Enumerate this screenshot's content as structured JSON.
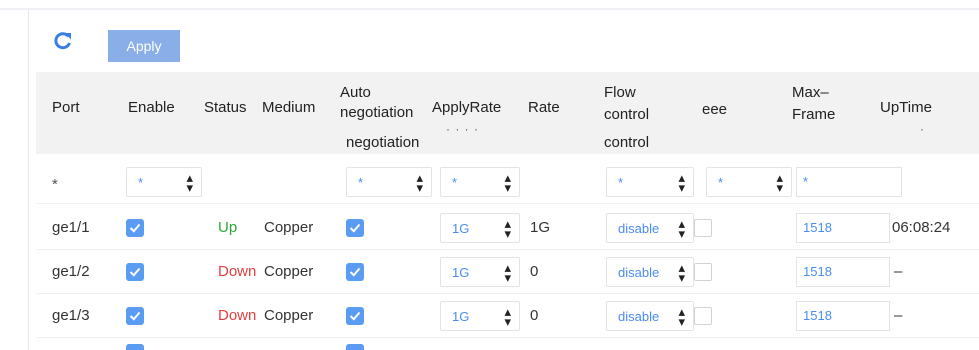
{
  "toolbar": {
    "apply_label": "Apply",
    "refresh_icon": "refresh-icon"
  },
  "columns": {
    "port": "Port",
    "enable": "Enable",
    "status": "Status",
    "medium": "Medium",
    "auto_line1": "Auto",
    "auto_line2": "negotiation",
    "auto_ghost": "negotiation",
    "applyrate": "ApplyRate",
    "rate": "Rate",
    "flow_line1": "Flow",
    "flow_line2": "control",
    "flow_ghost": "control",
    "eee": "eee",
    "max_line1": "Max–",
    "max_line2": "Frame",
    "uptime": "UpTime"
  },
  "filter": {
    "port": "*",
    "enable": "*",
    "auto": "*",
    "applyrate": "*",
    "flow": "*",
    "eee": "*",
    "maxframe": "*"
  },
  "rows": [
    {
      "port": "ge1/1",
      "enable": true,
      "status": "Up",
      "medium": "Copper",
      "auto": true,
      "applyrate": "1G",
      "rate": "1G",
      "flow": "disable",
      "eee": false,
      "maxframe": "1518",
      "uptime": "06:08:24"
    },
    {
      "port": "ge1/2",
      "enable": true,
      "status": "Down",
      "medium": "Copper",
      "auto": true,
      "applyrate": "1G",
      "rate": "0",
      "flow": "disable",
      "eee": false,
      "maxframe": "1518",
      "uptime": "–"
    },
    {
      "port": "ge1/3",
      "enable": true,
      "status": "Down",
      "medium": "Copper",
      "auto": true,
      "applyrate": "1G",
      "rate": "0",
      "flow": "disable",
      "eee": false,
      "maxframe": "1518",
      "uptime": "–"
    }
  ],
  "colors": {
    "accent": "#4a8df0",
    "apply_button": "#8aaee8",
    "up": "#2fa83b",
    "down": "#e04040",
    "header_bg": "#f2f2f2"
  }
}
